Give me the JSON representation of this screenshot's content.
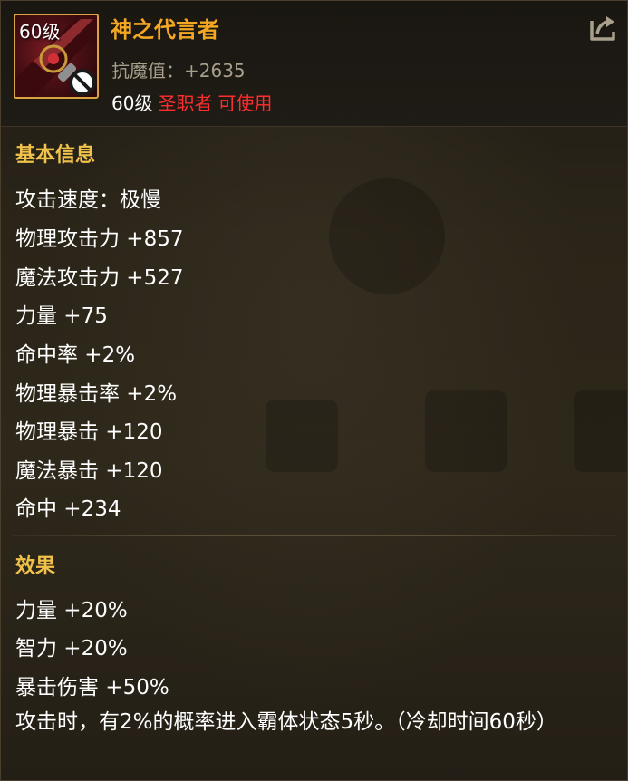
{
  "item": {
    "level_badge": "60级",
    "name": "神之代言者",
    "resist_label": "抗魔值：+2635",
    "req_level": "60级",
    "req_class": "圣职者",
    "req_usable": "可使用",
    "icon": "holy-staff-icon"
  },
  "header": {
    "share_icon": "share-icon"
  },
  "basic_info": {
    "title": "基本信息",
    "stats": [
      "攻击速度：极慢",
      "物理攻击力 +857",
      "魔法攻击力 +527",
      "力量 +75",
      "命中率 +2%",
      "物理暴击率 +2%",
      "物理暴击 +120",
      "魔法暴击 +120",
      "命中 +234"
    ]
  },
  "effects": {
    "title": "效果",
    "stats": [
      "力量 +20%",
      "智力 +20%",
      "暴击伤害 +50%"
    ],
    "description": "攻击时，有2%的概率进入霸体状态5秒。（冷却时间60秒）"
  },
  "colors": {
    "item_name": "#f3a722",
    "section_title": "#f0c24a",
    "restricted": "#ff2e2e",
    "icon_border": "#d8a340"
  }
}
